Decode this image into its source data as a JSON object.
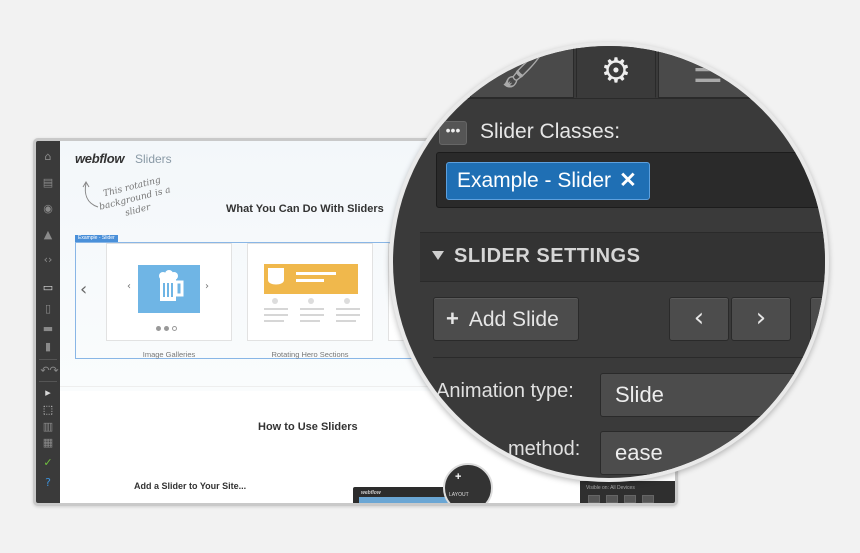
{
  "colors": {
    "accent": "#1f6fb4",
    "panel_dark": "#3a3a3a",
    "hero_yellow": "#f0b84c",
    "gallery_blue": "#6fb5e5",
    "success_green": "#6fbf3f"
  },
  "window": {
    "logo": "webflow",
    "page_name": "Sliders",
    "toolbar_icons": [
      "home-icon",
      "page-icon",
      "eye-icon",
      "rocket-icon",
      "code-icon",
      "desktop-icon",
      "tablet-icon",
      "phone-landscape-icon",
      "phone-icon",
      "undo-icon",
      "redo-icon",
      "play-icon",
      "select-icon",
      "grid-icon",
      "table-icon",
      "check-icon",
      "help-icon"
    ],
    "handwritten_note": "This rotating background is a slider",
    "section1_title": "What You Can Do With Sliders",
    "selected_label": "Example - Slider",
    "slides": [
      {
        "caption": "Image Galleries"
      },
      {
        "caption": "Rotating Hero Sections"
      }
    ],
    "section2_title": "How to Use Sliders",
    "subsection_title": "Add a Slider to Your Site...",
    "mini_logo": "webflow",
    "mini_layout": "LAYOUT",
    "visible_on": "Visible on: All Devices"
  },
  "panel": {
    "tabs": [
      {
        "icon": "brush-icon",
        "glyph": "🖌"
      },
      {
        "icon": "gear-icon",
        "glyph": "⚙",
        "active": true
      },
      {
        "icon": "list-icon",
        "glyph": "☰"
      }
    ],
    "classes_label": "Slider Classes:",
    "class_chip": "Example - Slider",
    "chip_remove": "✕",
    "section_title": "SLIDER SETTINGS",
    "add_slide_label": "Add Slide",
    "prev_glyph": "‹",
    "next_glyph": "›",
    "animation_label": "Animation type:",
    "animation_value": "Slide",
    "easing_label": "method:",
    "easing_value": "ease"
  }
}
